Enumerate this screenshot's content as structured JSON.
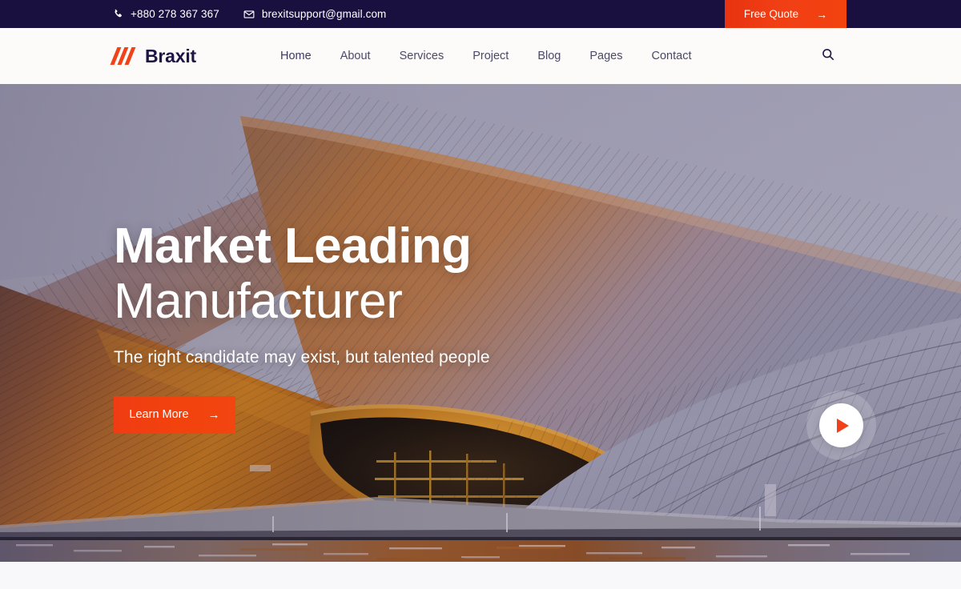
{
  "topbar": {
    "phone_icon": "phone-icon",
    "phone": "+880 278 367 367",
    "email_icon": "envelope-icon",
    "email": "brexitsupport@gmail.com",
    "cta_label": "Free Quote",
    "cta_arrow": "→",
    "bg_color": "#1a1040",
    "cta_color": "#f2420e"
  },
  "header": {
    "logo_text": "Braxit",
    "logo_mark": "diagonal-stripes-logo",
    "search_icon": "search-icon",
    "nav": [
      {
        "label": "Home",
        "active": true
      },
      {
        "label": "About",
        "active": false
      },
      {
        "label": "Services",
        "active": false
      },
      {
        "label": "Project",
        "active": false
      },
      {
        "label": "Blog",
        "active": false
      },
      {
        "label": "Pages",
        "active": false
      },
      {
        "label": "Contact",
        "active": false
      }
    ],
    "bg_color": "#fcfbfa",
    "text_color": "#4b4a66",
    "active_underline_color": "#f0431a"
  },
  "hero": {
    "title_line1": "Market Leading",
    "title_line2": "Manufacturer",
    "subtitle": "The right candidate may exist, but talented people",
    "cta_label": "Learn More",
    "cta_arrow": "→",
    "play_icon": "play-icon",
    "background_image": "curved-copper-clad-architecture-at-dusk",
    "sky_color": "#a5a3b5",
    "copper_color": "#b8662c",
    "steel_color": "#8f8ea3",
    "cta_color": "#f2420e"
  },
  "page": {
    "background_color": "#f8f7f9"
  }
}
